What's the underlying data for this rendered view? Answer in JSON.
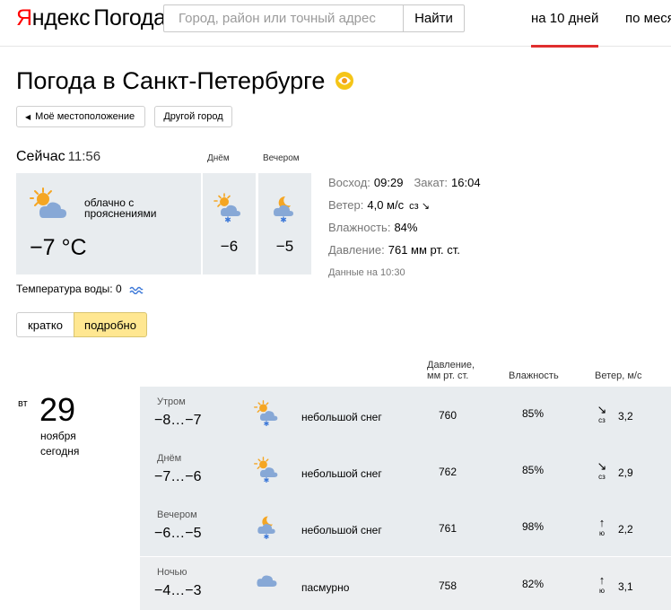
{
  "header": {
    "logo_ya": "Я",
    "logo_brand": "ндекс",
    "logo_service": "Погода",
    "search_placeholder": "Город, район или точный адрес",
    "search_button": "Найти",
    "nav": [
      "на 10 дней",
      "по меся"
    ]
  },
  "title": "Погода в Санкт-Петербурге",
  "buttons": {
    "my_location": "Моё местоположение",
    "other_city": "Другой город"
  },
  "now": {
    "label": "Сейчас",
    "time": "11:56",
    "description": "облачно с прояснениями",
    "temp": "−7 °C",
    "day_label": "Днём",
    "day_temp": "−6",
    "evening_label": "Вечером",
    "evening_temp": "−5",
    "icon": "partly-cloudy-icon",
    "day_icon": "sun-cloud-snow-icon",
    "evening_icon": "moon-cloud-snow-icon"
  },
  "facts": {
    "sunrise_label": "Восход:",
    "sunrise": "09:29",
    "sunset_label": "Закат:",
    "sunset": "16:04",
    "wind_label": "Ветер:",
    "wind": "4,0 м/с",
    "wind_dir": "сз ↘",
    "humidity_label": "Влажность:",
    "humidity": "84%",
    "pressure_label": "Давление:",
    "pressure": "761 мм рт. ст.",
    "data_time": "Данные на 10:30"
  },
  "water": {
    "label": "Температура воды:",
    "value": "0"
  },
  "view_toggle": {
    "short": "кратко",
    "detail": "подробно",
    "selected": "подробно"
  },
  "table": {
    "pressure_header_1": "Давление,",
    "pressure_header_2": "мм рт. ст.",
    "humidity_header": "Влажность",
    "wind_header": "Ветер, м/с"
  },
  "day": {
    "weekday": "вт",
    "date": "29",
    "month": "ноября",
    "relative": "сегодня"
  },
  "rows": [
    {
      "part": "Утром",
      "range": "−8…−7",
      "icon": "sun-cloud-snow-icon",
      "condition": "небольшой снег",
      "pressure": "760",
      "humidity": "85%",
      "wind_arrow": "↘",
      "wind_dir": "сз",
      "wind": "3,2"
    },
    {
      "part": "Днём",
      "range": "−7…−6",
      "icon": "sun-cloud-snow-icon",
      "condition": "небольшой снег",
      "pressure": "762",
      "humidity": "85%",
      "wind_arrow": "↘",
      "wind_dir": "сз",
      "wind": "2,9"
    },
    {
      "part": "Вечером",
      "range": "−6…−5",
      "icon": "moon-cloud-snow-icon",
      "condition": "небольшой снег",
      "pressure": "761",
      "humidity": "98%",
      "wind_arrow": "↑",
      "wind_dir": "ю",
      "wind": "2,2"
    },
    {
      "part": "Ночью",
      "range": "−4…−3",
      "icon": "cloud-icon",
      "condition": "пасмурно",
      "pressure": "758",
      "humidity": "82%",
      "wind_arrow": "↑",
      "wind_dir": "ю",
      "wind": "3,1"
    }
  ],
  "colors": {
    "accent": "#e02e2e",
    "card": "#e8ecef",
    "selected": "#ffe791"
  }
}
